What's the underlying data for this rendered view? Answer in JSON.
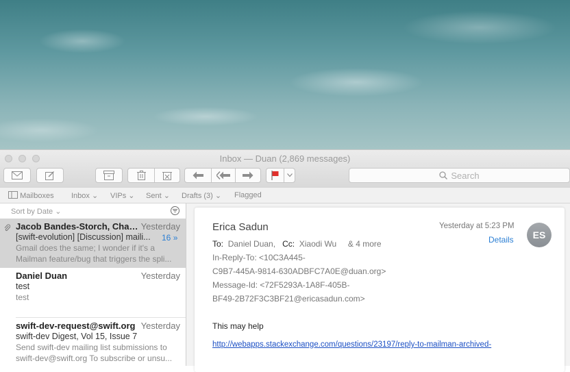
{
  "window": {
    "title": "Inbox — Duan (2,869 messages)"
  },
  "toolbar": {
    "icons": [
      "envelope-icon",
      "compose-icon",
      "archive-icon",
      "trash-icon",
      "junk-icon",
      "reply-icon",
      "reply-all-icon",
      "forward-icon",
      "flag-icon",
      "chevron-down-icon"
    ],
    "search_placeholder": "Search"
  },
  "favorites": {
    "mailboxes": "Mailboxes",
    "inbox": "Inbox",
    "vips": "VIPs",
    "sent": "Sent",
    "drafts": "Drafts (3)",
    "flagged": "Flagged"
  },
  "list": {
    "sort_label": "Sort by Date",
    "messages": [
      {
        "sender": "Jacob Bandes-Storch, Charl...",
        "date": "Yesterday",
        "subject": "[swift-evolution] [Discussion] maili...",
        "count": "16",
        "preview1": "Gmail does the same; I wonder if it's a",
        "preview2": "Mailman feature/bug that triggers the spli..."
      },
      {
        "sender": "Daniel Duan",
        "date": "Yesterday",
        "subject": "test",
        "preview1": "test"
      },
      {
        "sender": "swift-dev-request@swift.org",
        "date": "Yesterday",
        "subject": "swift-dev Digest, Vol 15, Issue 7",
        "preview1": "Send swift-dev mailing list submissions to",
        "preview2": "swift-dev@swift.org To subscribe or unsu..."
      }
    ]
  },
  "reader": {
    "from": "Erica Sadun",
    "timestamp": "Yesterday at 5:23 PM",
    "details": "Details",
    "avatar": "ES",
    "to_label": "To:",
    "to_value": "Daniel Duan,",
    "cc_label": "Cc:",
    "cc_value": "Xiaodi Wu",
    "more": "& 4 more",
    "in_reply_to_1": "In-Reply-To: <10C3A445-",
    "in_reply_to_2": "C9B7-445A-9814-630ADBFC7A0E@duan.org>",
    "message_id_1": "Message-Id: <72F5293A-1A8F-405B-",
    "message_id_2": "BF49-2B72F3C3BF21@ericasadun.com>",
    "body": "This may help",
    "link": "http://webapps.stackexchange.com/questions/23197/reply-to-mailman-archived-"
  },
  "colors": {
    "accent": "#2b7fd4",
    "flag": "#e0312d",
    "selection": "#d4d4d4"
  }
}
